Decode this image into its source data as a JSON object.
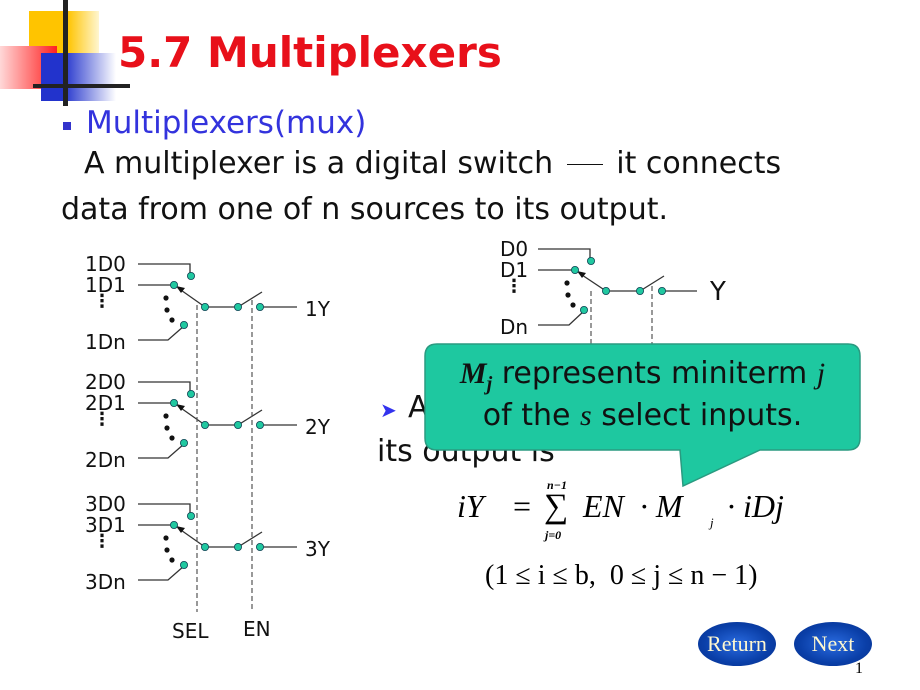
{
  "slide": {
    "title": "5.7 Multiplexers",
    "subtitle": "Multiplexers(mux)",
    "line1_a": "A multiplexer is a digital switch",
    "line1_b": "it connects",
    "line2": "data from one of n sources to its output.",
    "bullet2_start": "A",
    "bullet2_line2": "its output is",
    "page_number": "1"
  },
  "left_diagram": {
    "groups": [
      {
        "d0": "1D0",
        "d1": "1D1",
        "dn": "1Dn",
        "y": "1Y"
      },
      {
        "d0": "2D0",
        "d1": "2D1",
        "dn": "2Dn",
        "y": "2Y"
      },
      {
        "d0": "3D0",
        "d1": "3D1",
        "dn": "3Dn",
        "y": "3Y"
      }
    ],
    "sel_label": "SEL",
    "en_label": "EN"
  },
  "right_diagram": {
    "d0": "D0",
    "d1": "D1",
    "dn": "Dn",
    "y": "Y"
  },
  "callout": {
    "m": "M",
    "m_sub": "j",
    "text1": "represents miniterm",
    "j": "j",
    "text2a": "of the",
    "s": "s",
    "text2b": "select inputs.",
    "color": "#1ec8a0"
  },
  "formula": {
    "lhs": "iY",
    "eq": "=",
    "sum_top": "n−1",
    "sum_bottom": "j=0",
    "sigma": "∑",
    "terms": "EN  · M",
    "m_sub": "j",
    "tail": "· iDj",
    "condition": "(1 ≤ i ≤ b,  0 ≤ j ≤ n − 1)"
  },
  "nav": {
    "return_label": "Return",
    "next_label": "Next"
  },
  "colors": {
    "title": "#e8101a",
    "subtitle": "#3333dd",
    "node": "#20c8a0",
    "button": "#0a3fa8"
  }
}
